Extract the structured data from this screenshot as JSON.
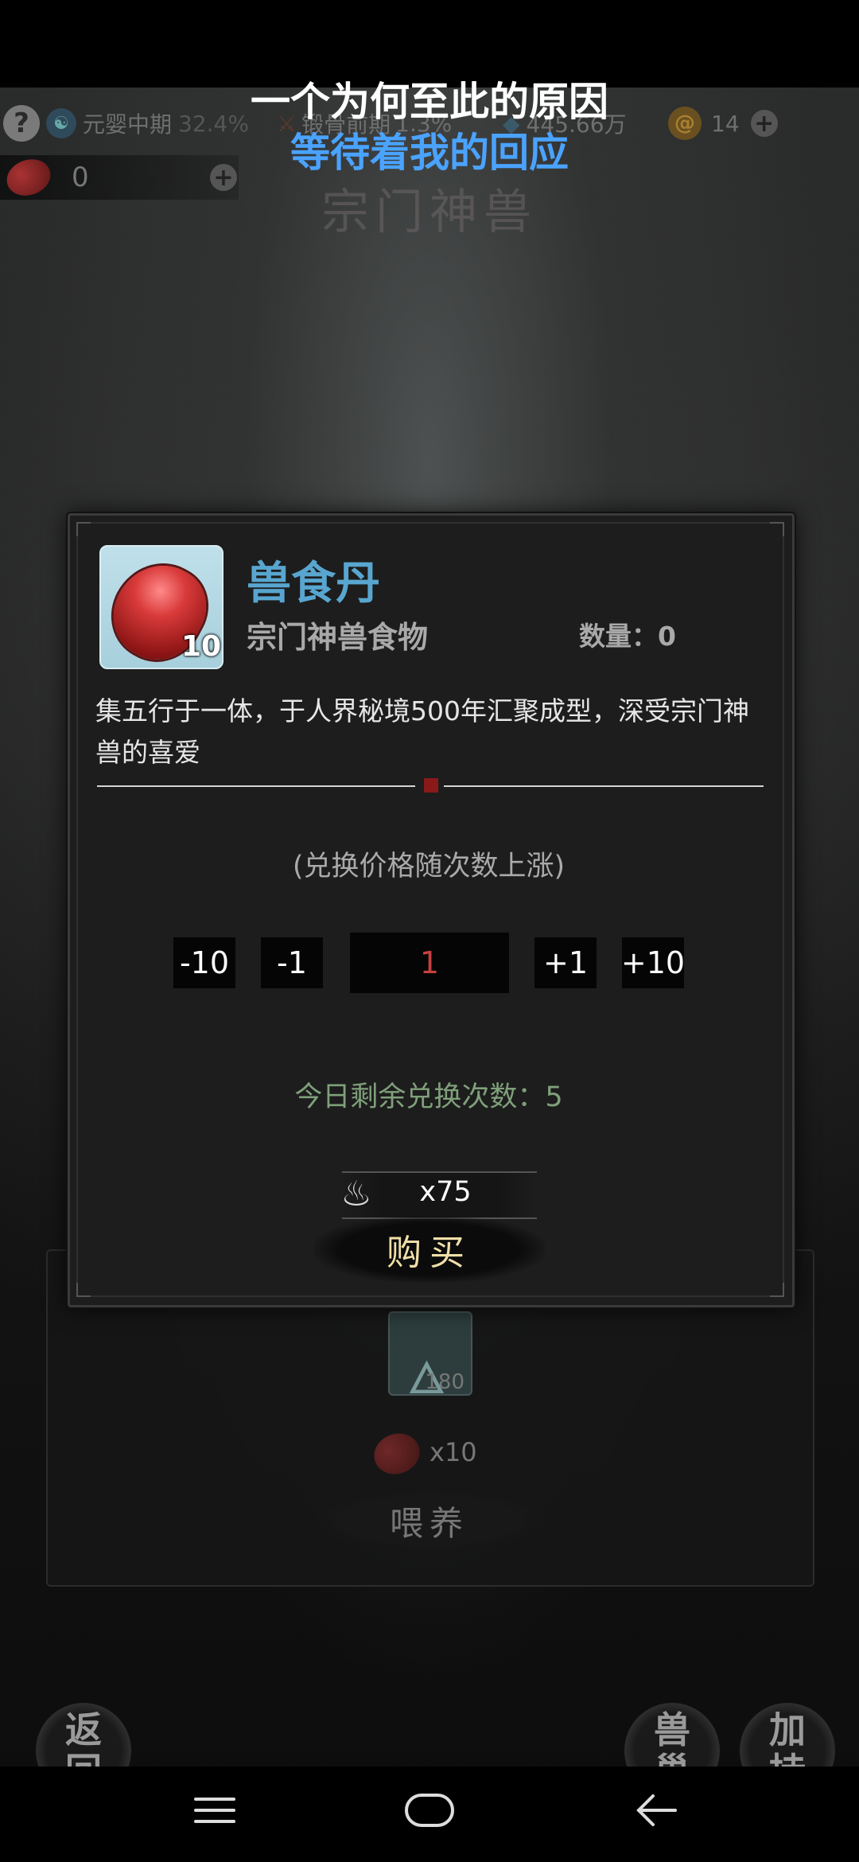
{
  "overlay": {
    "lyric_line1": "一个为何至此的原因",
    "lyric_line2": "等待着我的回应"
  },
  "topbar": {
    "realm": "元婴中期",
    "realm_progress": "32.4%",
    "stage": "锻骨前期",
    "stage_progress": "1.3%",
    "spirit_stones": "445.66万",
    "currency_count": "14"
  },
  "food_bar": {
    "count": "0"
  },
  "section_title": "宗门神兽",
  "dialog": {
    "item_name": "兽食丹",
    "item_icon_count": "10",
    "item_type": "宗门神兽食物",
    "quantity_label": "数量：0",
    "description": "集五行于一体，于人界秘境500年汇聚成型，深受宗门神兽的喜爱",
    "price_note": "(兑换价格随次数上涨)",
    "stepper": {
      "minus10": "-10",
      "minus1": "-1",
      "value": "1",
      "plus1": "+1",
      "plus10": "+10"
    },
    "remaining_exchanges": "今日剩余兑换次数：5",
    "cost": "x75",
    "buy_label": "购买"
  },
  "feed_panel": {
    "icon_count": "180",
    "cost": "x10",
    "feed_label": "喂养"
  },
  "bottom_buttons": {
    "back": "返回",
    "beast_nest": "兽巢",
    "boost": "加持"
  },
  "colors": {
    "item_name": "#58a6d0",
    "quantity_value": "#c84040",
    "remaining_text": "#7fa07a",
    "buy_text": "#f0dfa8",
    "lyric_highlight": "#4aa3ff"
  }
}
